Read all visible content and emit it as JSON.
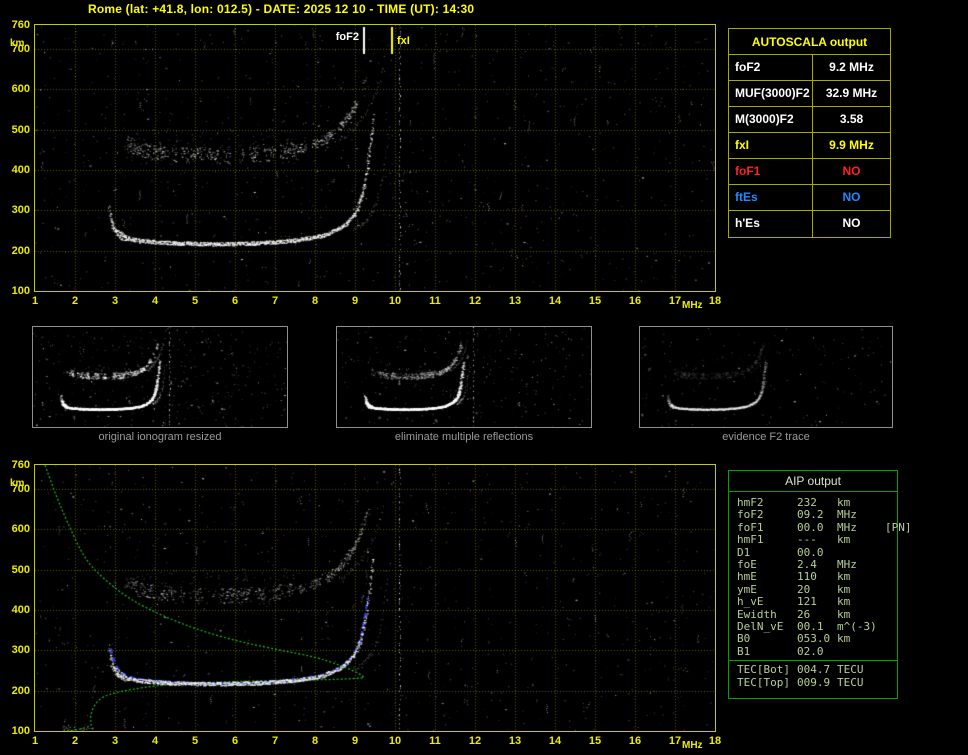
{
  "title": "Rome (lat: +41.8, lon: 012.5) - DATE: 2025 12 10 - TIME (UT): 14:30",
  "colors": {
    "background": "#000000",
    "accent_yellow": "#ffff00",
    "grid_yellow": "#aaaa00",
    "trace_white": "#ffffff",
    "profile_green": "#22bb22",
    "restored_blue": "#2b3cff",
    "aip_border_green": "#00a400",
    "no_red": "#ff2222",
    "es_blue": "#2288ff",
    "caption_gray": "#9a9a9a"
  },
  "autoscala_table": {
    "header": "AUTOSCALA output",
    "rows": [
      {
        "label": "foF2",
        "value": "9.2 MHz",
        "color": "#ffffff"
      },
      {
        "label": "MUF(3000)F2",
        "value": "32.9 MHz",
        "color": "#ffffff"
      },
      {
        "label": "M(3000)F2",
        "value": "3.58",
        "color": "#ffffff"
      },
      {
        "label": "fxI",
        "value": "9.9 MHz",
        "color": "#ffff00"
      },
      {
        "label": "foF1",
        "value": "NO",
        "color": "#ff2222"
      },
      {
        "label": "ftEs",
        "value": "NO",
        "color": "#2288ff"
      },
      {
        "label": "h'Es",
        "value": "NO",
        "color": "#ffffff"
      }
    ]
  },
  "thumbnails": [
    {
      "caption": "original ionogram resized"
    },
    {
      "caption": "eliminate multiple reflections"
    },
    {
      "caption": "evidence F2 trace"
    }
  ],
  "aip_table": {
    "header": "AIP output",
    "rows": [
      {
        "label": "hmF2",
        "value": "232",
        "unit": "km",
        "note": ""
      },
      {
        "label": "foF2",
        "value": "09.2",
        "unit": "MHz",
        "note": ""
      },
      {
        "label": "foF1",
        "value": "00.0",
        "unit": "MHz",
        "note": "[PN]"
      },
      {
        "label": "hmF1",
        "value": "---",
        "unit": "km",
        "note": ""
      },
      {
        "label": "D1",
        "value": "00.0",
        "unit": "",
        "note": ""
      },
      {
        "label": "foE",
        "value": "2.4",
        "unit": "MHz",
        "note": ""
      },
      {
        "label": "hmE",
        "value": "110",
        "unit": "km",
        "note": ""
      },
      {
        "label": "ymE",
        "value": "20",
        "unit": "km",
        "note": ""
      },
      {
        "label": "h_vE",
        "value": "121",
        "unit": "km",
        "note": ""
      },
      {
        "label": "Ewidth",
        "value": "26",
        "unit": "km",
        "note": ""
      },
      {
        "label": "DelN_vE",
        "value": "00.1",
        "unit": "m^(-3)",
        "note": ""
      },
      {
        "label": "B0",
        "value": "053.0",
        "unit": "km",
        "note": ""
      },
      {
        "label": "B1",
        "value": "02.0",
        "unit": "",
        "note": ""
      }
    ],
    "tec_rows": [
      {
        "label": "TEC[Bot]",
        "value": "004.7",
        "unit": "TECU"
      },
      {
        "label": "TEC[Top]",
        "value": "009.9",
        "unit": "TECU"
      }
    ]
  },
  "chart_data": [
    {
      "type": "scatter",
      "name": "top-ionogram",
      "xlabel": "MHz",
      "ylabel": "km",
      "xlim": [
        1,
        18
      ],
      "ylim": [
        100,
        760
      ],
      "x_ticks": [
        1,
        2,
        3,
        4,
        5,
        6,
        7,
        8,
        9,
        10,
        11,
        12,
        13,
        14,
        15,
        16,
        17,
        18
      ],
      "y_ticks": [
        100,
        200,
        300,
        400,
        500,
        600,
        700,
        760
      ],
      "grid": true,
      "markers": [
        {
          "label": "foF2",
          "x": 9.2,
          "color": "#ffffff"
        },
        {
          "label": "fxI",
          "x": 9.9,
          "color": "#ffff00"
        }
      ],
      "f2_trace": [
        [
          2.85,
          305
        ],
        [
          2.9,
          270
        ],
        [
          3.0,
          248
        ],
        [
          3.2,
          234
        ],
        [
          3.6,
          225
        ],
        [
          4.5,
          219
        ],
        [
          5.5,
          217
        ],
        [
          6.5,
          219
        ],
        [
          7.5,
          226
        ],
        [
          8.2,
          238
        ],
        [
          8.7,
          261
        ],
        [
          9.0,
          293
        ],
        [
          9.15,
          332
        ],
        [
          9.28,
          395
        ],
        [
          9.38,
          470
        ],
        [
          9.45,
          530
        ]
      ],
      "second_hop": [
        [
          3.3,
          468
        ],
        [
          3.6,
          452
        ],
        [
          4.0,
          444
        ],
        [
          5.0,
          437
        ],
        [
          6.0,
          436
        ],
        [
          7.0,
          443
        ],
        [
          7.8,
          457
        ],
        [
          8.3,
          480
        ],
        [
          8.7,
          517
        ],
        [
          9.0,
          562
        ],
        [
          9.2,
          612
        ],
        [
          9.32,
          655
        ]
      ],
      "rfi_line_x": 10.1
    },
    {
      "type": "scatter",
      "name": "bottom-ionogram",
      "xlabel": "MHz",
      "ylabel": "km",
      "xlim": [
        1,
        18
      ],
      "ylim": [
        100,
        760
      ],
      "x_ticks": [
        1,
        2,
        3,
        4,
        5,
        6,
        7,
        8,
        9,
        10,
        11,
        12,
        13,
        14,
        15,
        16,
        17,
        18
      ],
      "y_ticks": [
        100,
        200,
        300,
        400,
        500,
        600,
        700,
        760
      ],
      "grid": true,
      "markers": [],
      "f2_trace": [
        [
          2.85,
          305
        ],
        [
          2.9,
          270
        ],
        [
          3.0,
          248
        ],
        [
          3.2,
          234
        ],
        [
          3.6,
          225
        ],
        [
          4.5,
          219
        ],
        [
          5.5,
          217
        ],
        [
          6.5,
          219
        ],
        [
          7.5,
          226
        ],
        [
          8.2,
          238
        ],
        [
          8.7,
          261
        ],
        [
          9.0,
          293
        ],
        [
          9.15,
          332
        ],
        [
          9.28,
          395
        ],
        [
          9.38,
          470
        ],
        [
          9.45,
          530
        ]
      ],
      "second_hop": [
        [
          3.3,
          468
        ],
        [
          3.6,
          452
        ],
        [
          4.0,
          444
        ],
        [
          5.0,
          437
        ],
        [
          6.0,
          436
        ],
        [
          7.0,
          443
        ],
        [
          7.8,
          457
        ],
        [
          8.3,
          480
        ],
        [
          8.7,
          517
        ],
        [
          9.0,
          562
        ],
        [
          9.2,
          612
        ],
        [
          9.32,
          655
        ]
      ],
      "profile_topside": [
        [
          1.25,
          760
        ],
        [
          1.5,
          690
        ],
        [
          1.8,
          620
        ],
        [
          2.25,
          524
        ],
        [
          2.8,
          470
        ],
        [
          3.4,
          425
        ],
        [
          4.2,
          385
        ],
        [
          5.1,
          350
        ],
        [
          6.1,
          322
        ],
        [
          7.1,
          301
        ],
        [
          8.0,
          284
        ],
        [
          8.6,
          264
        ],
        [
          9.0,
          248
        ],
        [
          9.2,
          236
        ],
        [
          9.25,
          232
        ]
      ],
      "profile_bottomside": [
        [
          9.25,
          232
        ],
        [
          8.6,
          228
        ],
        [
          7.5,
          226
        ],
        [
          6.0,
          223
        ],
        [
          4.8,
          218
        ],
        [
          4.0,
          212
        ],
        [
          3.4,
          203
        ],
        [
          3.0,
          195
        ],
        [
          2.7,
          185
        ],
        [
          2.55,
          172
        ],
        [
          2.45,
          158
        ],
        [
          2.4,
          142
        ],
        [
          2.38,
          128
        ],
        [
          2.42,
          118
        ],
        [
          2.38,
          112
        ],
        [
          2.15,
          105
        ],
        [
          1.9,
          101
        ],
        [
          1.7,
          100
        ]
      ],
      "restored_trace": [
        [
          2.9,
          305
        ],
        [
          3.0,
          262
        ],
        [
          3.2,
          240
        ],
        [
          3.6,
          228
        ],
        [
          4.5,
          220
        ],
        [
          5.5,
          217
        ],
        [
          6.5,
          219
        ],
        [
          7.5,
          226
        ],
        [
          8.2,
          238
        ],
        [
          8.7,
          260
        ],
        [
          9.0,
          292
        ],
        [
          9.15,
          330
        ],
        [
          9.25,
          385
        ],
        [
          9.32,
          430
        ]
      ],
      "rfi_line_x": 10.1
    }
  ]
}
